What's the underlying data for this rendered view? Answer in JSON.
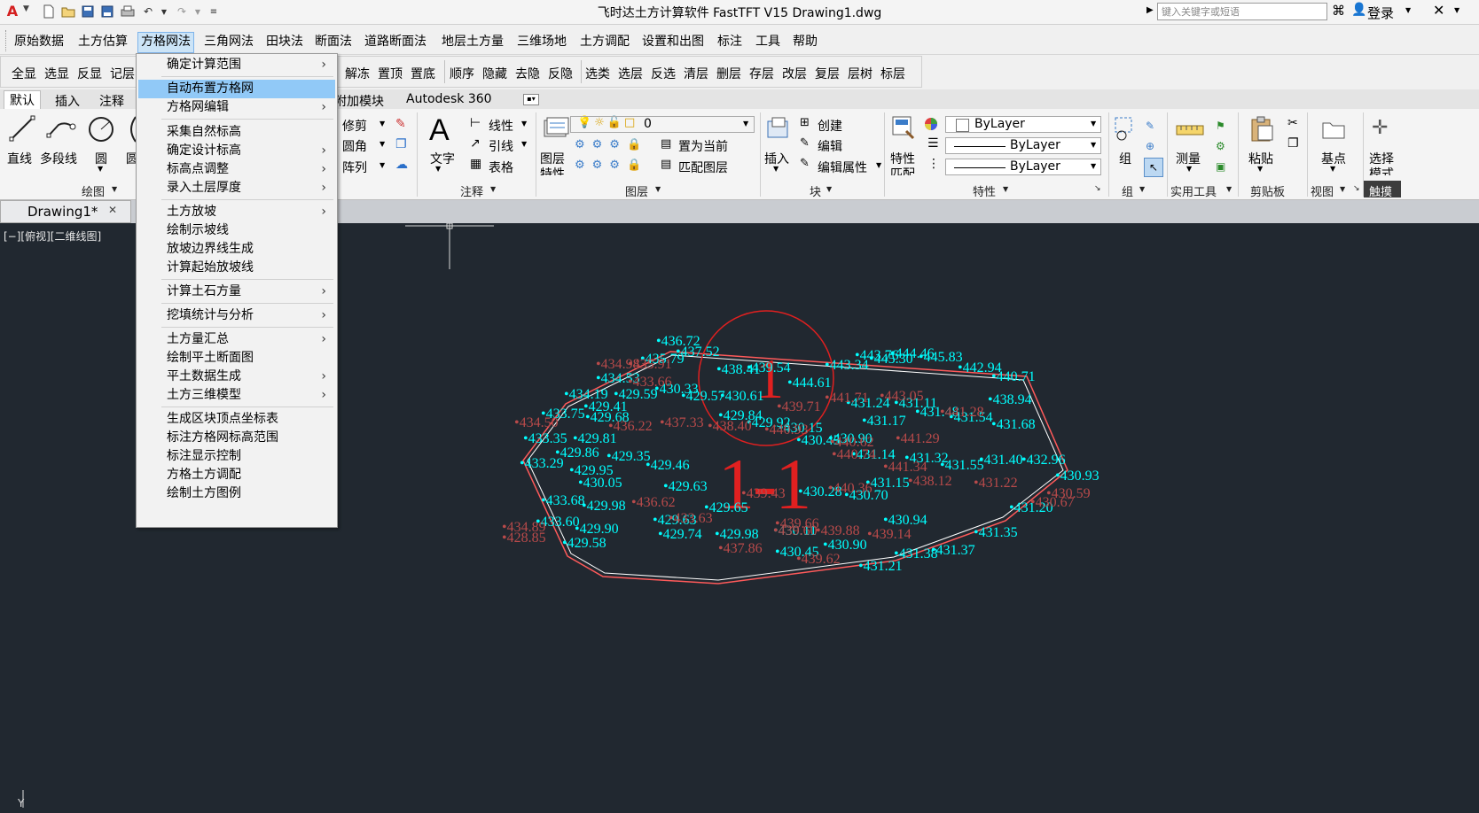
{
  "title_bar": {
    "title": "飞时达土方计算软件 FastTFT V15    Drawing1.dwg",
    "search_placeholder": "键入关键字或短语",
    "login": "登录",
    "app_logo": "A",
    "accent": "#d42020"
  },
  "menubar": {
    "items": [
      "原始数据",
      "土方估算",
      "方格网法",
      "三角网法",
      "田块法",
      "断面法",
      "道路断面法",
      "地层土方量",
      "三维场地",
      "土方调配",
      "设置和出图",
      "标注",
      "工具",
      "帮助"
    ]
  },
  "toolbar2": {
    "left_items": [
      "全显",
      "选显",
      "反显",
      "记层"
    ],
    "right_items": [
      "解冻",
      "置顶",
      "置底",
      "顺序",
      "隐藏",
      "去隐",
      "反隐",
      "选类",
      "选层",
      "反选",
      "清层",
      "删层",
      "存层",
      "改层",
      "复层",
      "层树",
      "标层"
    ]
  },
  "ribbon_tabs": {
    "items": [
      "默认",
      "插入",
      "注释"
    ],
    "items_right": [
      "附加模块",
      "Autodesk 360"
    ]
  },
  "ribbon": {
    "draw": {
      "line": "直线",
      "polyline": "多段线",
      "circle": "圆",
      "arc": "圆",
      "caption": "绘图"
    },
    "modify": {
      "trim": "修剪",
      "fillet": "圆角",
      "array": "阵列"
    },
    "annotation": {
      "text": "文字",
      "linear": "线性",
      "leader": "引线",
      "table": "表格",
      "caption": "注释"
    },
    "layers": {
      "props": "图层",
      "props2": "特性",
      "layer_value": "0",
      "set_current": "置为当前",
      "match_layer": "匹配图层",
      "caption": "图层"
    },
    "block": {
      "insert": "插入",
      "create": "创建",
      "edit": "编辑",
      "edit_attr": "编辑属性",
      "caption": "块"
    },
    "properties": {
      "match": "特性",
      "match2": "匹配",
      "color": "ByLayer",
      "linetype": "ByLayer",
      "lineweight": "ByLayer",
      "caption": "特性"
    },
    "groups": {
      "group": "组",
      "caption": "组"
    },
    "utilities": {
      "measure": "测量",
      "caption": "实用工具"
    },
    "clipboard": {
      "paste": "粘贴",
      "caption": "剪贴板"
    },
    "view": {
      "base": "基点",
      "caption": "视图"
    },
    "select": {
      "mode": "选择",
      "mode2": "模式",
      "caption": "触摸"
    }
  },
  "doc_tab": {
    "label": "Drawing1*"
  },
  "canvas": {
    "view_label": "[−][俯视][二维线图]",
    "section_small": "1",
    "section_big": "1-1",
    "ucs_label": "Y",
    "cyan_labels": [
      "436.72",
      "437.52",
      "435.79",
      "434.53",
      "439.54",
      "438.41",
      "444.61",
      "443.34",
      "442.94",
      "440.71",
      "434.19",
      "429.59",
      "430.33",
      "429.57",
      "430.61",
      "429.41",
      "433.75",
      "429.68",
      "438.94",
      "431.17",
      "431.11",
      "431.24",
      "431.48",
      "431.54",
      "431.68",
      "429.84",
      "429.92",
      "430.15",
      "430.45",
      "430.90",
      "433.35",
      "429.81",
      "429.86",
      "429.35",
      "429.46",
      "433.29",
      "429.95",
      "430.05",
      "429.63",
      "431.14",
      "431.32",
      "431.55",
      "431.40",
      "432.96",
      "430.93",
      "430.28",
      "430.70",
      "431.15",
      "433.68",
      "429.98",
      "429.65",
      "429.63",
      "431.20",
      "430.94",
      "431.35",
      "433.60",
      "429.90",
      "429.74",
      "429.98",
      "430.11",
      "430.45",
      "430.90",
      "429.58",
      "431.21",
      "431.38",
      "431.37",
      "445.30",
      "445.83",
      "444.46",
      "443.76"
    ],
    "red_labels": [
      "434.98",
      "435.91",
      "433.66",
      "434.50",
      "439.71",
      "443.05",
      "441.71",
      "437.33",
      "438.40",
      "436.22",
      "440.93",
      "441.28",
      "441.29",
      "440.74",
      "440.36",
      "441.34",
      "439.43",
      "440.62",
      "436.62",
      "438.12",
      "433.63",
      "439.60",
      "439.88",
      "439.66",
      "439.14",
      "430.67",
      "430.59",
      "431.22",
      "428.85",
      "434.89",
      "437.86",
      "439.62"
    ]
  }
}
